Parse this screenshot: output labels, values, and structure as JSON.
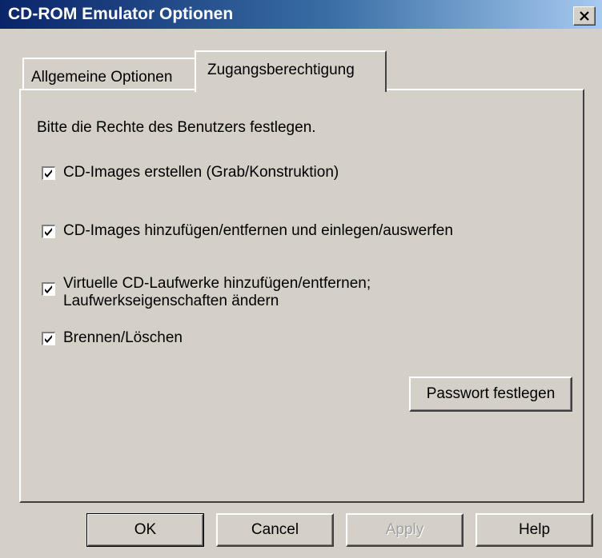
{
  "window": {
    "title": "CD-ROM Emulator Optionen"
  },
  "tabs": [
    {
      "label": "Allgemeine Optionen",
      "active": false
    },
    {
      "label": "Zugangsberechtigung",
      "active": true
    }
  ],
  "panel": {
    "intro": "Bitte die Rechte des Benutzers festlegen.",
    "permissions": [
      {
        "label": "CD-Images erstellen (Grab/Konstruktion)",
        "checked": true
      },
      {
        "label": "CD-Images hinzufügen/entfernen und einlegen/auswerfen",
        "checked": true
      },
      {
        "label": "Virtuelle CD-Laufwerke hinzufügen/entfernen;\nLaufwerkseigenschaften ändern",
        "checked": true
      },
      {
        "label": "Brennen/Löschen",
        "checked": true
      }
    ],
    "set_password_button": "Passwort festlegen"
  },
  "buttons": {
    "ok": "OK",
    "cancel": "Cancel",
    "apply": "Apply",
    "help": "Help"
  },
  "icons": {
    "close": "close-icon",
    "check": "checkmark-icon"
  },
  "colors": {
    "title_gradient_start": "#0a246a",
    "title_gradient_end": "#a6caf0",
    "face": "#d4d0c8"
  }
}
